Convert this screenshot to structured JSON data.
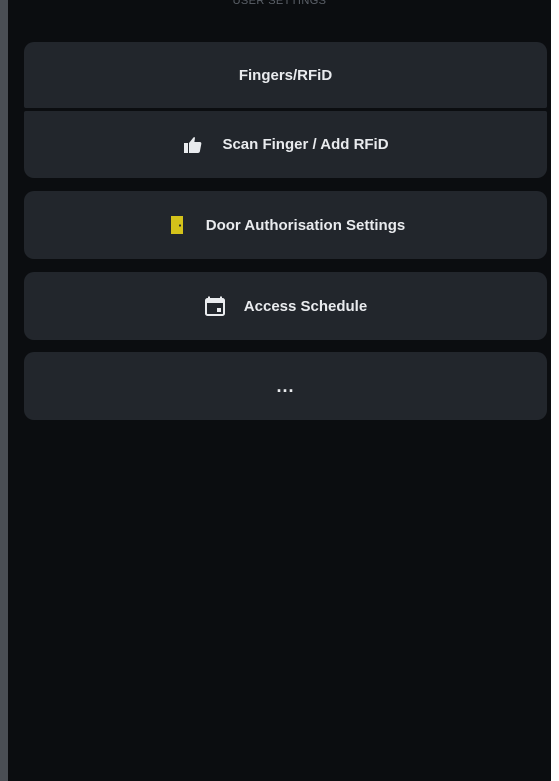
{
  "header": {
    "title": "USER SETTINGS"
  },
  "menu": {
    "fingers_rfid": {
      "label": "Fingers/RFiD"
    },
    "scan_finger": {
      "label": "Scan Finger / Add RFiD",
      "icon": "thumbs-up-icon"
    },
    "door_authorisation": {
      "label": "Door Authorisation Settings",
      "icon": "door-icon"
    },
    "access_schedule": {
      "label": "Access Schedule",
      "icon": "calendar-icon"
    },
    "more": {
      "label": "..."
    }
  },
  "colors": {
    "background": "#0b0d10",
    "item_background": "#22262c",
    "text": "#e9ebee",
    "header_text": "#5b6068",
    "door_icon": "#d4c21a"
  }
}
